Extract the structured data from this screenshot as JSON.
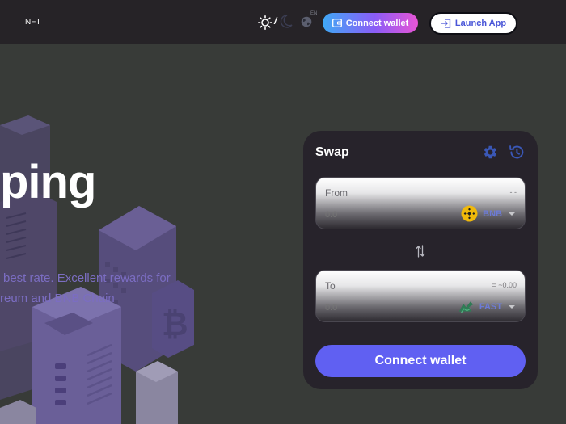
{
  "nav": {
    "nft_label": "NFT",
    "lang_label": "EN",
    "connect_label": "Connect wallet",
    "launch_label": "Launch App"
  },
  "theme": {
    "separator": "/"
  },
  "hero": {
    "title_fragment": "ping",
    "line1": "best rate. Excellent rewards for",
    "line2": "reum and BNB Chain"
  },
  "swap": {
    "title": "Swap",
    "from": {
      "label": "From",
      "balance": "- -",
      "amount_placeholder": "0.0",
      "token": "BNB"
    },
    "to": {
      "label": "To",
      "balance": "= ~0.00",
      "amount_placeholder": "0.0",
      "token": "FAST"
    },
    "connect_label": "Connect wallet"
  },
  "colors": {
    "accent": "#6060f2",
    "gear": "#3a57b6",
    "bnb": "#f0b90b",
    "fast": "#2f7b55"
  },
  "icons": [
    "sun-icon",
    "moon-icon",
    "globe-icon",
    "wallet-icon",
    "launch-icon",
    "gear-icon",
    "history-icon",
    "swap-arrows-icon",
    "bnb-token-icon",
    "fast-token-icon"
  ]
}
